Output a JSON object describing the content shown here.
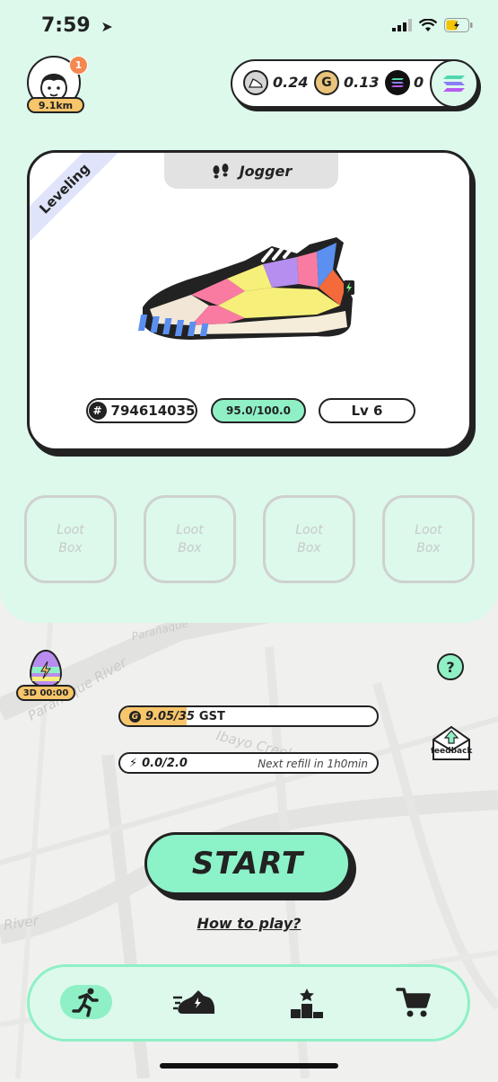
{
  "status_bar": {
    "time": "7:59"
  },
  "profile": {
    "distance": "9.1km",
    "notification_count": "1"
  },
  "wallet": {
    "gst": "0.24",
    "gmt": "0.13",
    "sol": "0"
  },
  "sneaker": {
    "type": "Jogger",
    "status": "Leveling",
    "id": "794614035",
    "durability": "95.0/100.0",
    "level": "Lv 6"
  },
  "loot_boxes": [
    {
      "label_line1": "Loot",
      "label_line2": "Box"
    },
    {
      "label_line1": "Loot",
      "label_line2": "Box"
    },
    {
      "label_line1": "Loot",
      "label_line2": "Box"
    },
    {
      "label_line1": "Loot",
      "label_line2": "Box"
    }
  ],
  "egg": {
    "timer": "3D 00:00"
  },
  "gst_cap": {
    "text": "9.05/35",
    "unit": "GST",
    "progress": 0.26
  },
  "energy": {
    "text": "0.0/2.0",
    "refill": "Next refill in 1h0min",
    "progress": 0.0
  },
  "help_label": "?",
  "feedback_label": "feedback",
  "start_label": "START",
  "how_to_play": "How to play?",
  "map_labels": [
    "Parañaque River",
    "Parañaque",
    "Ibayo Creek",
    "River"
  ],
  "nav": [
    "run-icon",
    "sneaker-icon",
    "leaderboard-icon",
    "cart-icon"
  ],
  "colors": {
    "mint": "#dcf9ec",
    "accent": "#8ff0c5",
    "gold": "#f7c56a"
  }
}
